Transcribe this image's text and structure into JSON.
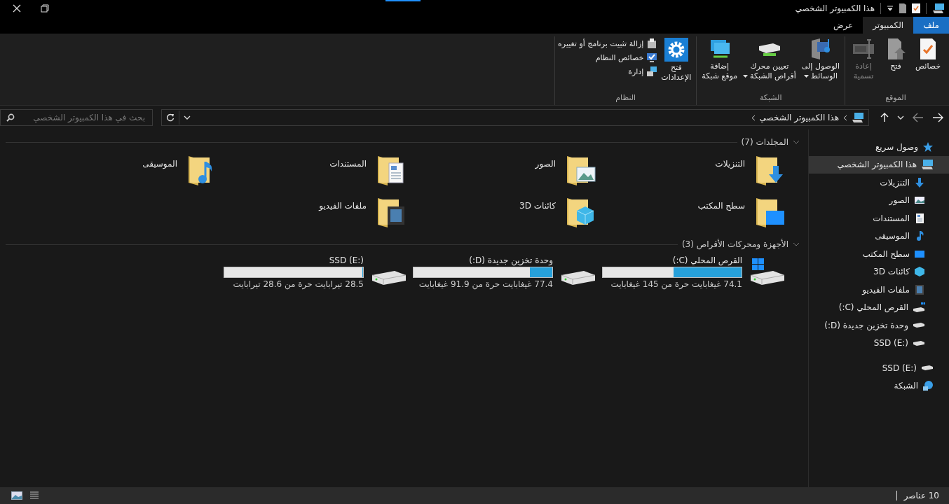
{
  "window": {
    "title": "هذا الكمبيوتر الشخصي"
  },
  "tabs": [
    {
      "label": "ملف",
      "kind": "file",
      "selected": false
    },
    {
      "label": "الكمبيوتر",
      "kind": "tab",
      "selected": true
    },
    {
      "label": "عرض",
      "kind": "tab",
      "selected": false
    }
  ],
  "ribbon": {
    "groups": [
      {
        "label": "الموقع",
        "items": [
          {
            "label": "خصائص",
            "kind": "properties",
            "menu": false,
            "disabled": false
          },
          {
            "label": "فتح",
            "kind": "open",
            "menu": false,
            "disabled": false
          },
          {
            "label": "إعادة\nتسمية",
            "kind": "rename",
            "menu": false,
            "disabled": true
          }
        ]
      },
      {
        "label": "الشبكة",
        "items": [
          {
            "label": "الوصول إلى\nالوسائط",
            "kind": "media",
            "menu": true,
            "disabled": false
          },
          {
            "label": "تعيين محرك\nأقراص الشبكة",
            "kind": "mapdrive",
            "menu": true,
            "disabled": false
          },
          {
            "label": "إضافة\nموقع شبكة",
            "kind": "netloc",
            "menu": false,
            "disabled": false
          }
        ]
      },
      {
        "label": "النظام",
        "items": [
          {
            "label": "فتح\nالإعدادات",
            "kind": "settings",
            "menu": false,
            "disabled": false
          }
        ],
        "links": [
          {
            "label": "إزالة تثبيت برنامج أو تغييره",
            "kind": "uninstall",
            "disabled": false
          },
          {
            "label": "خصائص النظام",
            "kind": "sysprops",
            "disabled": false
          },
          {
            "label": "إدارة",
            "kind": "manage",
            "disabled": false
          }
        ]
      }
    ]
  },
  "address_bar": {
    "path": "هذا الكمبيوتر الشخصي"
  },
  "search": {
    "placeholder": "بحث في هذا الكمبيوتر الشخصي"
  },
  "sidebar": {
    "items": [
      {
        "label": "وصول سريع",
        "kind": "quick",
        "selected": false
      },
      {
        "label": "هذا الكمبيوتر الشخصي",
        "kind": "pc",
        "selected": true,
        "children": [
          {
            "label": "التنزيلات",
            "kind": "downloads",
            "selected": false
          },
          {
            "label": "الصور",
            "kind": "pictures",
            "selected": false
          },
          {
            "label": "المستندات",
            "kind": "documents",
            "selected": false
          },
          {
            "label": "الموسيقى",
            "kind": "music",
            "selected": false
          },
          {
            "label": "سطح المكتب",
            "kind": "desktop",
            "selected": false
          },
          {
            "label": "كائنات 3D",
            "kind": "objects",
            "selected": false
          },
          {
            "label": "ملفات الفيديو",
            "kind": "videos",
            "selected": false
          },
          {
            "label": "القرص المحلي (C:)",
            "kind": "system",
            "selected": false
          },
          {
            "label": "وحدة تخزين جديدة (D:)",
            "kind": "drive",
            "selected": false
          },
          {
            "label": "SSD (E:)",
            "kind": "drive",
            "selected": false
          }
        ]
      },
      {
        "label": "SSD (E:)",
        "kind": "drive",
        "selected": false
      },
      {
        "label": "الشبكة",
        "kind": "network",
        "selected": false
      }
    ]
  },
  "folders": {
    "title": "المجلدات (7)",
    "expanded": true,
    "items": [
      {
        "label": "التنزيلات",
        "kind": "downloads"
      },
      {
        "label": "الصور",
        "kind": "pictures"
      },
      {
        "label": "المستندات",
        "kind": "documents"
      },
      {
        "label": "الموسيقى",
        "kind": "music"
      },
      {
        "label": "سطح المكتب",
        "kind": "desktop"
      },
      {
        "label": "كائنات 3D",
        "kind": "objects"
      },
      {
        "label": "ملفات الفيديو",
        "kind": "videos"
      }
    ]
  },
  "drives": {
    "title": "الأجهزة ومحركات الأقراص (3)",
    "expanded": true,
    "items": [
      {
        "label": "القرص المحلي (C:)",
        "kind": "system",
        "level": 0.49,
        "space": "74.1 غيغابايت حرة من 145 غيغابايت"
      },
      {
        "label": "وحدة تخزين جديدة (D:)",
        "kind": "drive",
        "level": 0.16,
        "space": "77.4 غيغابايت حرة من 91.9 غيغابايت"
      },
      {
        "label": "SSD (E:)",
        "kind": "drive",
        "level": 0.004,
        "space": "28.5 تيرابايت حرة من 28.6 تيرابايت"
      }
    ]
  },
  "status_bar": {
    "count": "10 عناصر"
  }
}
